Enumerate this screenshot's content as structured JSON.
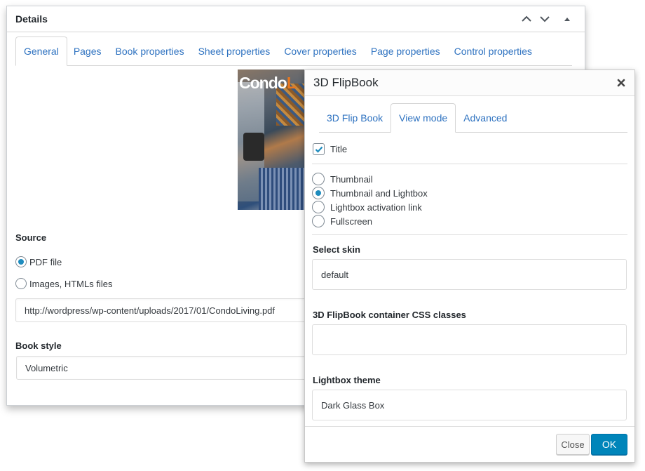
{
  "details": {
    "title": "Details",
    "controls": {
      "move_up": "chevron-up-icon",
      "move_down": "chevron-down-icon",
      "collapse": "triangle-up-icon"
    },
    "tabs": [
      {
        "label": "General",
        "active": true
      },
      {
        "label": "Pages",
        "active": false
      },
      {
        "label": "Book properties",
        "active": false
      },
      {
        "label": "Sheet properties",
        "active": false
      },
      {
        "label": "Cover properties",
        "active": false
      },
      {
        "label": "Page properties",
        "active": false
      },
      {
        "label": "Control properties",
        "active": false
      }
    ],
    "cover": {
      "title_white": "Condo",
      "title_orange": "L"
    },
    "source": {
      "label": "Source",
      "options": [
        {
          "label": "PDF file",
          "checked": true
        },
        {
          "label": "Images, HTMLs files",
          "checked": false
        }
      ],
      "url_value": "http://wordpress/wp-content/uploads/2017/01/CondoLiving.pdf"
    },
    "book_style": {
      "label": "Book style",
      "value": "Volumetric"
    }
  },
  "dialog": {
    "title": "3D FlipBook",
    "tabs": [
      {
        "label": "3D Flip Book",
        "active": false
      },
      {
        "label": "View mode",
        "active": true
      },
      {
        "label": "Advanced",
        "active": false
      }
    ],
    "title_checkbox": {
      "label": "Title",
      "checked": true
    },
    "view_modes": [
      {
        "label": "Thumbnail",
        "checked": false
      },
      {
        "label": "Thumbnail and Lightbox",
        "checked": true
      },
      {
        "label": "Lightbox activation link",
        "checked": false
      },
      {
        "label": "Fullscreen",
        "checked": false
      }
    ],
    "skin": {
      "label": "Select skin",
      "value": "default"
    },
    "css_classes": {
      "label": "3D FlipBook container CSS classes",
      "value": ""
    },
    "lightbox_theme": {
      "label": "Lightbox theme",
      "value": "Dark Glass Box"
    },
    "buttons": {
      "close": "Close",
      "ok": "OK"
    }
  },
  "colors": {
    "accent": "#0085ba",
    "link": "#2e72c0",
    "radio_dot": "#1e8cbe"
  }
}
